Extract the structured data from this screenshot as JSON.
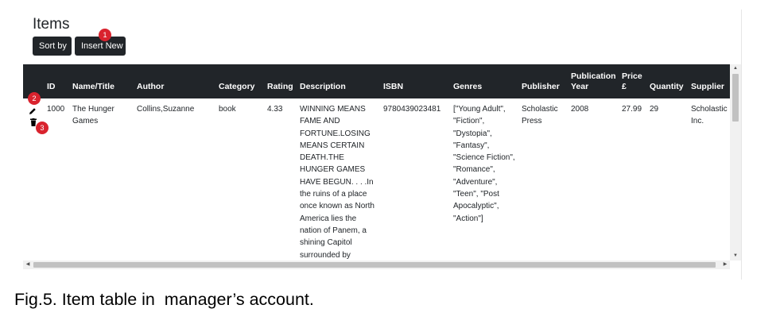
{
  "page": {
    "title": "Items"
  },
  "toolbar": {
    "sort_label": "Sort by",
    "insert_label": "Insert New"
  },
  "badges": [
    "1",
    "2",
    "3"
  ],
  "table": {
    "headers": {
      "id": "ID",
      "name": "Name/Title",
      "author": "Author",
      "category": "Category",
      "rating": "Rating",
      "description": "Description",
      "isbn": "ISBN",
      "genres": "Genres",
      "publisher": "Publisher",
      "pub_year": "Publication Year",
      "price": "Price £",
      "quantity": "Quantity",
      "supplier": "Supplier"
    },
    "rows": [
      {
        "id": "1000",
        "name": "The Hunger Games",
        "author": "Collins,Suzanne",
        "category": "book",
        "rating": "4.33",
        "description": "WINNING MEANS FAME AND FORTUNE.LOSING MEANS CERTAIN DEATH.THE HUNGER GAMES HAVE BEGUN. . . .In the ruins of a place once known as North America lies the nation of Panem, a shining Capitol surrounded by",
        "isbn": "9780439023481",
        "genres": "[\"Young Adult\", \"Fiction\", \"Dystopia\", \"Fantasy\", \"Science Fiction\", \"Romance\", \"Adventure\", \"Teen\", \"Post Apocalyptic\", \"Action\"]",
        "publisher": "Scholastic Press",
        "pub_year": "2008",
        "price": "27.99",
        "quantity": "29",
        "supplier": "Scholastic Inc."
      }
    ]
  },
  "icons": {
    "edit": "pencil-icon",
    "delete": "trash-icon"
  },
  "caption": "Fig.5. Item table in  manager’s account."
}
